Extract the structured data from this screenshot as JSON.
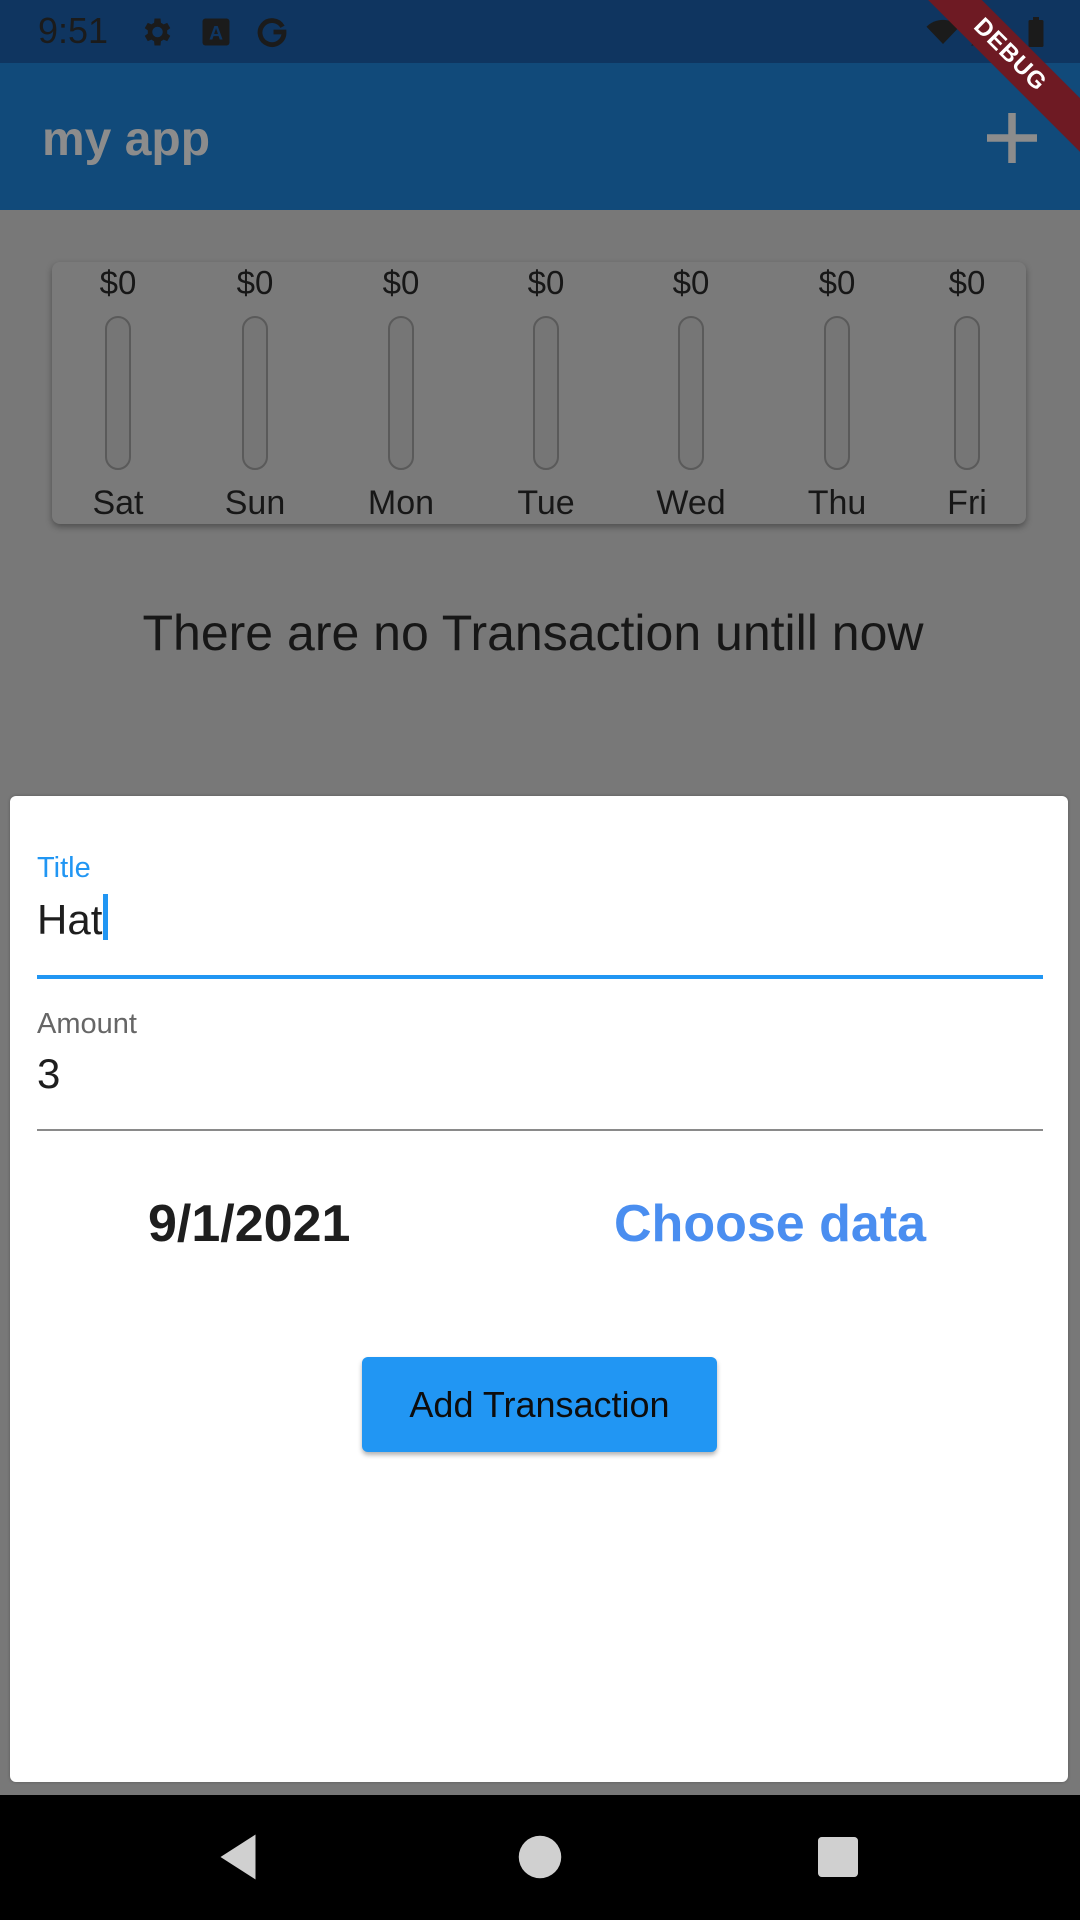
{
  "status_bar": {
    "time": "9:51",
    "icons": [
      "gear-icon",
      "a-icon",
      "g-icon",
      "wifi-icon",
      "signal-icon",
      "battery-icon"
    ]
  },
  "app_bar": {
    "title": "my app",
    "action_icon": "add-icon",
    "debug_banner": "DEBUG"
  },
  "chart_data": {
    "type": "bar",
    "categories": [
      "Sat",
      "Sun",
      "Mon",
      "Tue",
      "Wed",
      "Thu",
      "Fri"
    ],
    "values": [
      0,
      0,
      0,
      0,
      0,
      0,
      0
    ],
    "value_labels": [
      "$0",
      "$0",
      "$0",
      "$0",
      "$0",
      "$0",
      "$0"
    ],
    "ylim": [
      0,
      1
    ]
  },
  "empty_message": "There are no Transaction untill now",
  "form": {
    "title_label": "Title",
    "title_value": "Hat",
    "amount_label": "Amount",
    "amount_value": "3",
    "date_text": "9/1/2021",
    "choose_date_label": "Choose data",
    "submit_label": "Add Transaction"
  },
  "colors": {
    "primary": "#2196f3",
    "app_bar": "#114a7a",
    "status_bar": "#0f3560",
    "scrim": "#787878",
    "link": "#4a8ef0"
  },
  "nav_bar": {
    "icons": [
      "back-icon",
      "home-icon",
      "recents-icon"
    ]
  }
}
